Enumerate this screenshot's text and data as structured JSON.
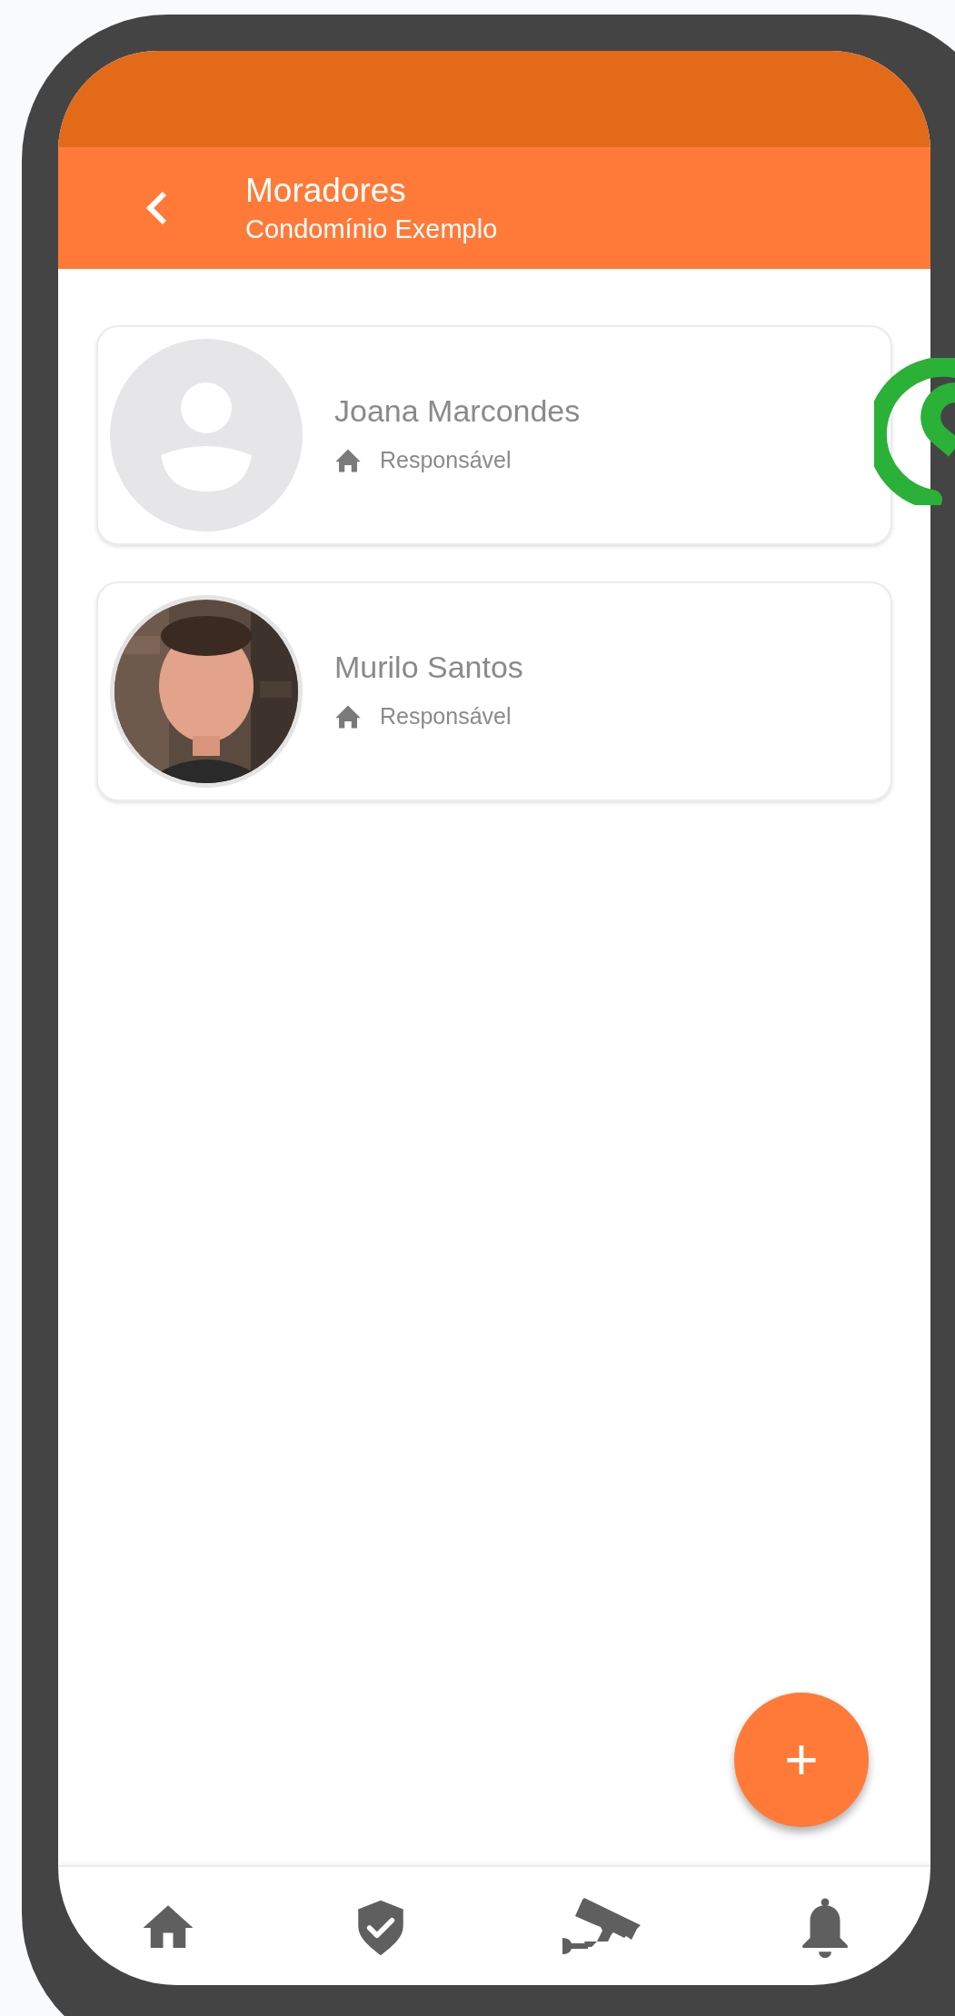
{
  "header": {
    "title": "Moradores",
    "subtitle": "Condomínio Exemplo"
  },
  "residents": [
    {
      "name": "Joana Marcondes",
      "role": "Responsável",
      "avatar": {
        "kind": "placeholder"
      }
    },
    {
      "name": "Murilo Santos",
      "role": "Responsável"
    }
  ],
  "fab": {
    "label": "+"
  }
}
